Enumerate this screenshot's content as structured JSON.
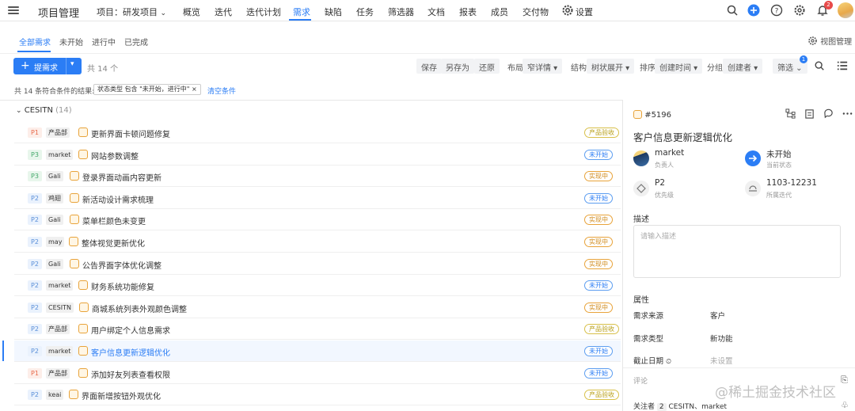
{
  "nav": {
    "app_title": "项目管理",
    "project": "项目：研发项目",
    "items": [
      "概览",
      "迭代",
      "迭代计划",
      "需求",
      "缺陷",
      "任务",
      "筛选器",
      "文档",
      "报表",
      "成员",
      "交付物",
      "设置"
    ],
    "notif_count": "2",
    "accent": "#2b7df5"
  },
  "subtabs": [
    "全部需求",
    "未开始",
    "进行中",
    "已完成"
  ],
  "view_manage": "视图管理",
  "toolbar": {
    "new_label": "提需求",
    "count": "共 14 个",
    "save": "保存",
    "save_as": "另存为",
    "restore": "还原",
    "layout_label": "布局",
    "layout_value": "窄详情",
    "struct_label": "结构",
    "struct_value": "树状展开",
    "sort_label": "排序",
    "sort_value": "创建时间",
    "group_label": "分组",
    "group_value": "创建者",
    "filter_label": "筛选",
    "filter_badge": "1"
  },
  "filter_line": {
    "result": "共 14 条符合条件的结果:",
    "chip": "状态类型 包含 \"未开始，进行中\" ×",
    "clear": "清空条件"
  },
  "group": {
    "name": "CESITN",
    "count": "(14)"
  },
  "rows": [
    {
      "pri": "P1",
      "assignee": "产品部",
      "title": "更新界面卡顿问题修复",
      "status": "产品验收",
      "st": "cpy"
    },
    {
      "pri": "P3",
      "assignee": "market",
      "title": "网站参数调整",
      "status": "未开始",
      "st": "wks"
    },
    {
      "pri": "P3",
      "assignee": "Gali",
      "title": "登录界面动画内容更新",
      "status": "实现中",
      "st": "sxz"
    },
    {
      "pri": "P2",
      "assignee": "鸡翅",
      "title": "新活动设计需求梳理",
      "status": "未开始",
      "st": "wks"
    },
    {
      "pri": "P2",
      "assignee": "Gali",
      "title": "菜单栏颜色未变更",
      "status": "实现中",
      "st": "sxz"
    },
    {
      "pri": "P2",
      "assignee": "may",
      "title": "整体视觉更新优化",
      "status": "实现中",
      "st": "sxz"
    },
    {
      "pri": "P2",
      "assignee": "Gali",
      "title": "公告界面字体优化调整",
      "status": "实现中",
      "st": "sxz"
    },
    {
      "pri": "P2",
      "assignee": "market",
      "title": "财务系统功能修复",
      "status": "未开始",
      "st": "wks"
    },
    {
      "pri": "P2",
      "assignee": "CESITN",
      "title": "商城系统列表外观颜色调整",
      "status": "实现中",
      "st": "sxz"
    },
    {
      "pri": "P2",
      "assignee": "产品部",
      "title": "用户绑定个人信息需求",
      "status": "产品验收",
      "st": "cpy"
    },
    {
      "pri": "P2",
      "assignee": "market",
      "title": "客户信息更新逻辑优化",
      "status": "未开始",
      "st": "wks"
    },
    {
      "pri": "P1",
      "assignee": "产品部",
      "title": "添加好友列表查看权限",
      "status": "未开始",
      "st": "wks"
    },
    {
      "pri": "P2",
      "assignee": "keai",
      "title": "界面新增按钮外观优化",
      "status": "产品验收",
      "st": "cpy"
    }
  ],
  "detail": {
    "id": "#5196",
    "title": "客户信息更新逻辑优化",
    "owner": "market",
    "owner_label": "负责人",
    "state": "未开始",
    "state_label": "当前状态",
    "priority": "P2",
    "priority_label": "优先级",
    "iteration": "1103-12231",
    "iteration_label": "所属迭代",
    "desc_label": "描述",
    "desc_placeholder": "请输入描述",
    "props_label": "属性",
    "props": [
      {
        "k": "需求来源",
        "v": "客户"
      },
      {
        "k": "需求类型",
        "v": "新功能"
      },
      {
        "k": "截止日期",
        "v": "未设置"
      }
    ],
    "comment_placeholder": "评论",
    "followers_label": "关注者",
    "followers_count": "2",
    "followers": "CESITN、market"
  },
  "watermark": "@稀土掘金技术社区"
}
